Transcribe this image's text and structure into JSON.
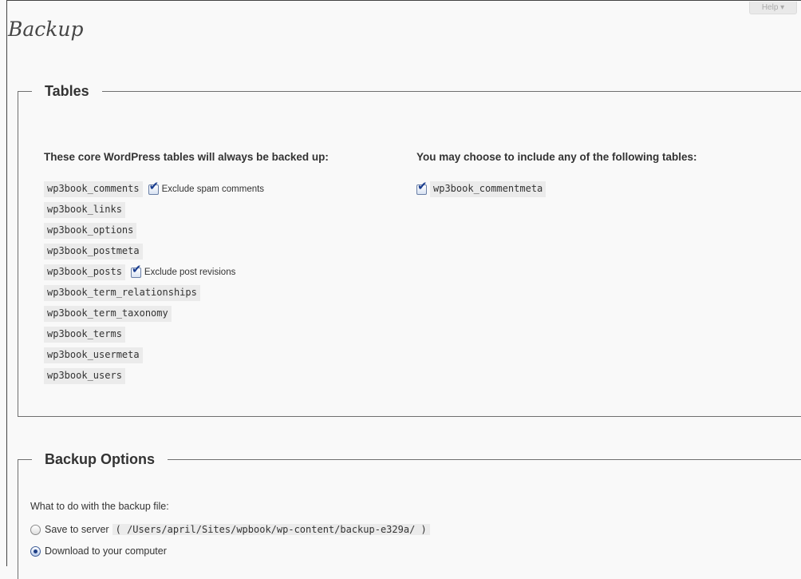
{
  "header": {
    "help_label": "Help ▾"
  },
  "page": {
    "title": "Backup"
  },
  "tables_section": {
    "legend": "Tables",
    "core_heading": "These core WordPress tables will always be backed up:",
    "optional_heading": "You may choose to include any of the following tables:",
    "core_tables": [
      {
        "name": "wp3book_comments",
        "option_label": "Exclude spam comments",
        "option_checked": true
      },
      {
        "name": "wp3book_links"
      },
      {
        "name": "wp3book_options"
      },
      {
        "name": "wp3book_postmeta"
      },
      {
        "name": "wp3book_posts",
        "option_label": "Exclude post revisions",
        "option_checked": true
      },
      {
        "name": "wp3book_term_relationships"
      },
      {
        "name": "wp3book_term_taxonomy"
      },
      {
        "name": "wp3book_terms"
      },
      {
        "name": "wp3book_usermeta"
      },
      {
        "name": "wp3book_users"
      }
    ],
    "optional_tables": [
      {
        "name": "wp3book_commentmeta",
        "checked": true
      }
    ]
  },
  "options_section": {
    "legend": "Backup Options",
    "question": "What to do with the backup file:",
    "choices": [
      {
        "label": "Save to server",
        "paren_open": "(",
        "path": "/Users/april/Sites/wpbook/wp-content/backup-e329a/",
        "paren_close": ")",
        "selected": false
      },
      {
        "label": "Download to your computer",
        "selected": true
      }
    ]
  }
}
